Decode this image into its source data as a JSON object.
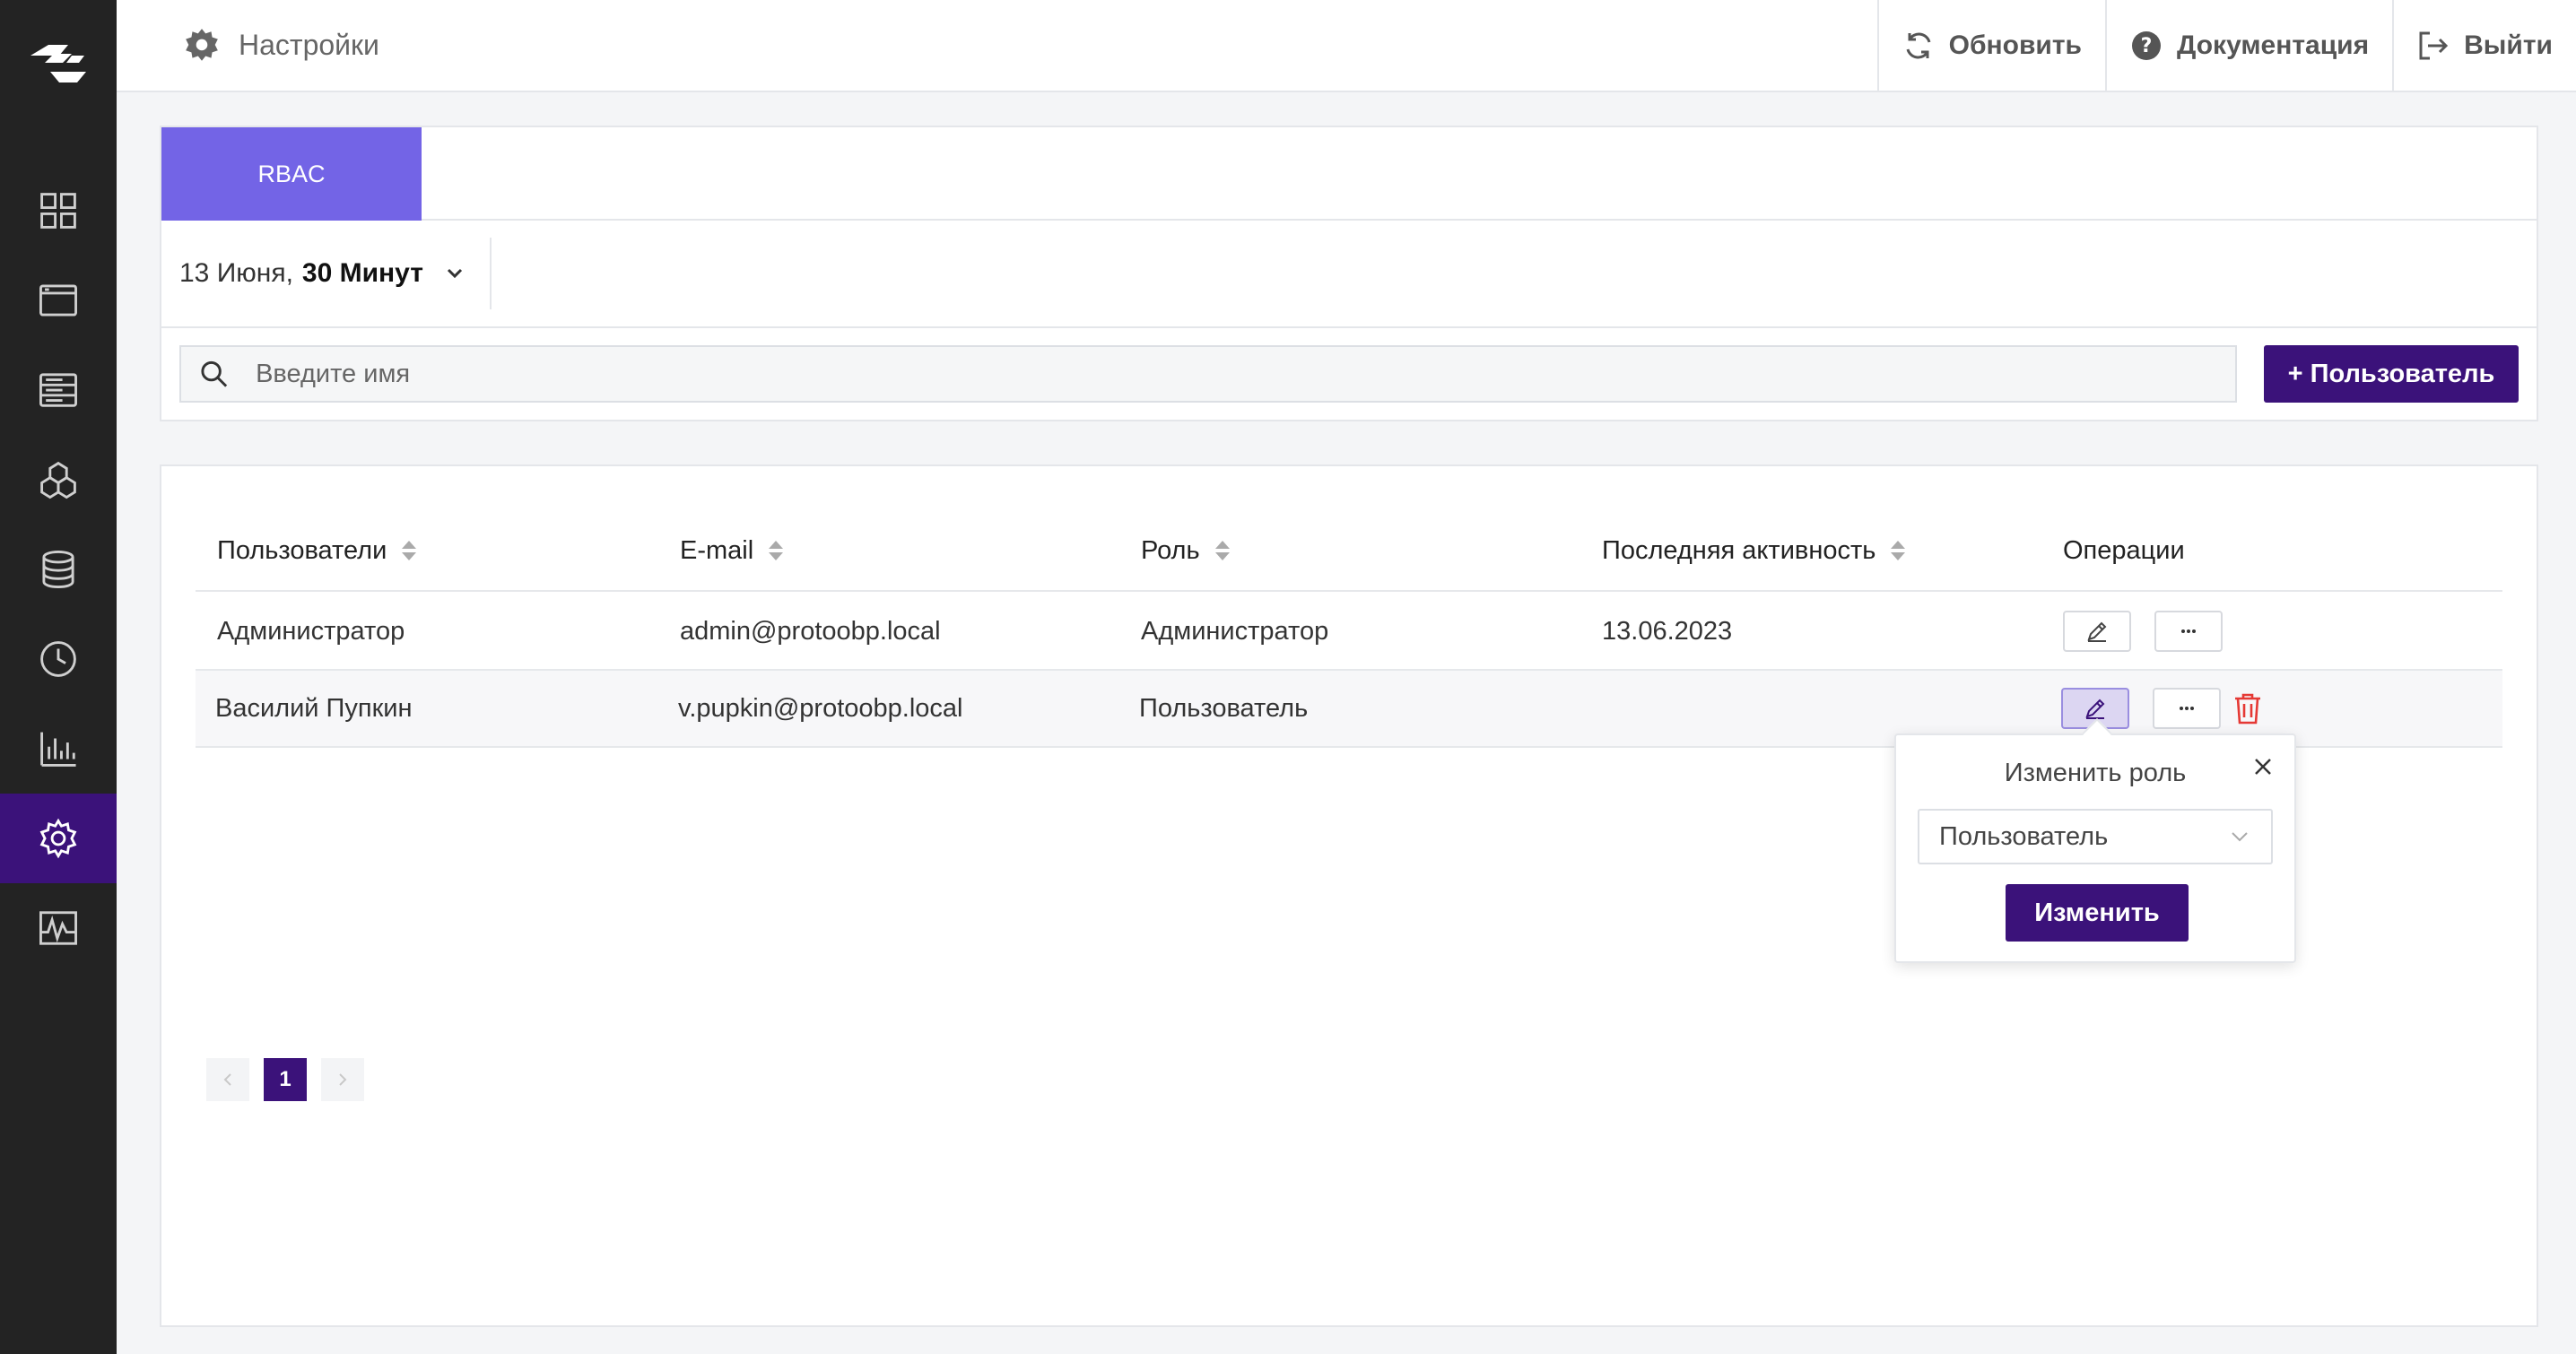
{
  "header": {
    "title": "Настройки",
    "refresh_label": "Обновить",
    "docs_label": "Документация",
    "logout_label": "Выйти"
  },
  "tabs": [
    {
      "label": "RBAC",
      "active": true
    }
  ],
  "period": {
    "date": "13 Июня,",
    "range": "30 Минут"
  },
  "search": {
    "placeholder": "Введите имя"
  },
  "add_user_label": "+ Пользователь",
  "table": {
    "columns": [
      "Пользователи",
      "E-mail",
      "Роль",
      "Последняя активность",
      "Операции"
    ],
    "rows": [
      {
        "name": "Администратор",
        "email": "admin@protoobp.local",
        "role": "Администратор",
        "last_active": "13.06.2023"
      },
      {
        "name": "Василий Пупкин",
        "email": "v.pupkin@protoobp.local",
        "role": "Пользователь",
        "last_active": ""
      }
    ]
  },
  "popover": {
    "title": "Изменить роль",
    "selected_role": "Пользователь",
    "submit_label": "Изменить"
  },
  "pagination": {
    "current": "1"
  },
  "colors": {
    "sidebar": "#232323",
    "accent": "#3b127a",
    "tab": "#7364e6",
    "danger": "#e53935"
  }
}
